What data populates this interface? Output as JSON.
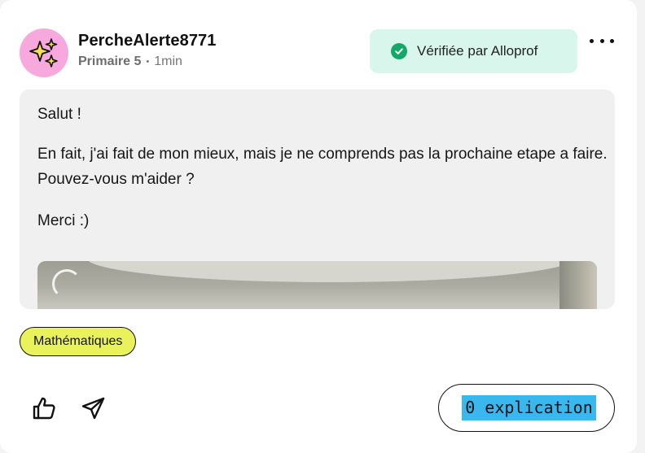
{
  "post": {
    "author": {
      "username": "PercheAlerte8771",
      "avatar_icon": "sparkles-icon",
      "avatar_color": "#f7a8dd",
      "grade": "Primaire 5",
      "separator": "•",
      "time": "1min"
    },
    "verified_badge": {
      "label": "Vérifiée par Alloprof",
      "icon": "check-circle-icon",
      "background": "#d9f6ec",
      "icon_color": "#13a86a"
    },
    "more_menu_icon": "more-horizontal-icon",
    "body": {
      "paragraphs": [
        "Salut !",
        "En fait, j'ai fait de mon mieux, mais je ne comprends pas la prochaine etape a faire. Pouvez-vous m'aider ?",
        "Merci :)"
      ]
    },
    "subject_tag": {
      "label": "Mathématiques",
      "background": "#e9f25a"
    }
  },
  "actions": {
    "like_icon": "thumbs-up-icon",
    "share_icon": "send-icon",
    "explanations_label": "0 explication",
    "explanations_highlight": "#39b8ee"
  }
}
